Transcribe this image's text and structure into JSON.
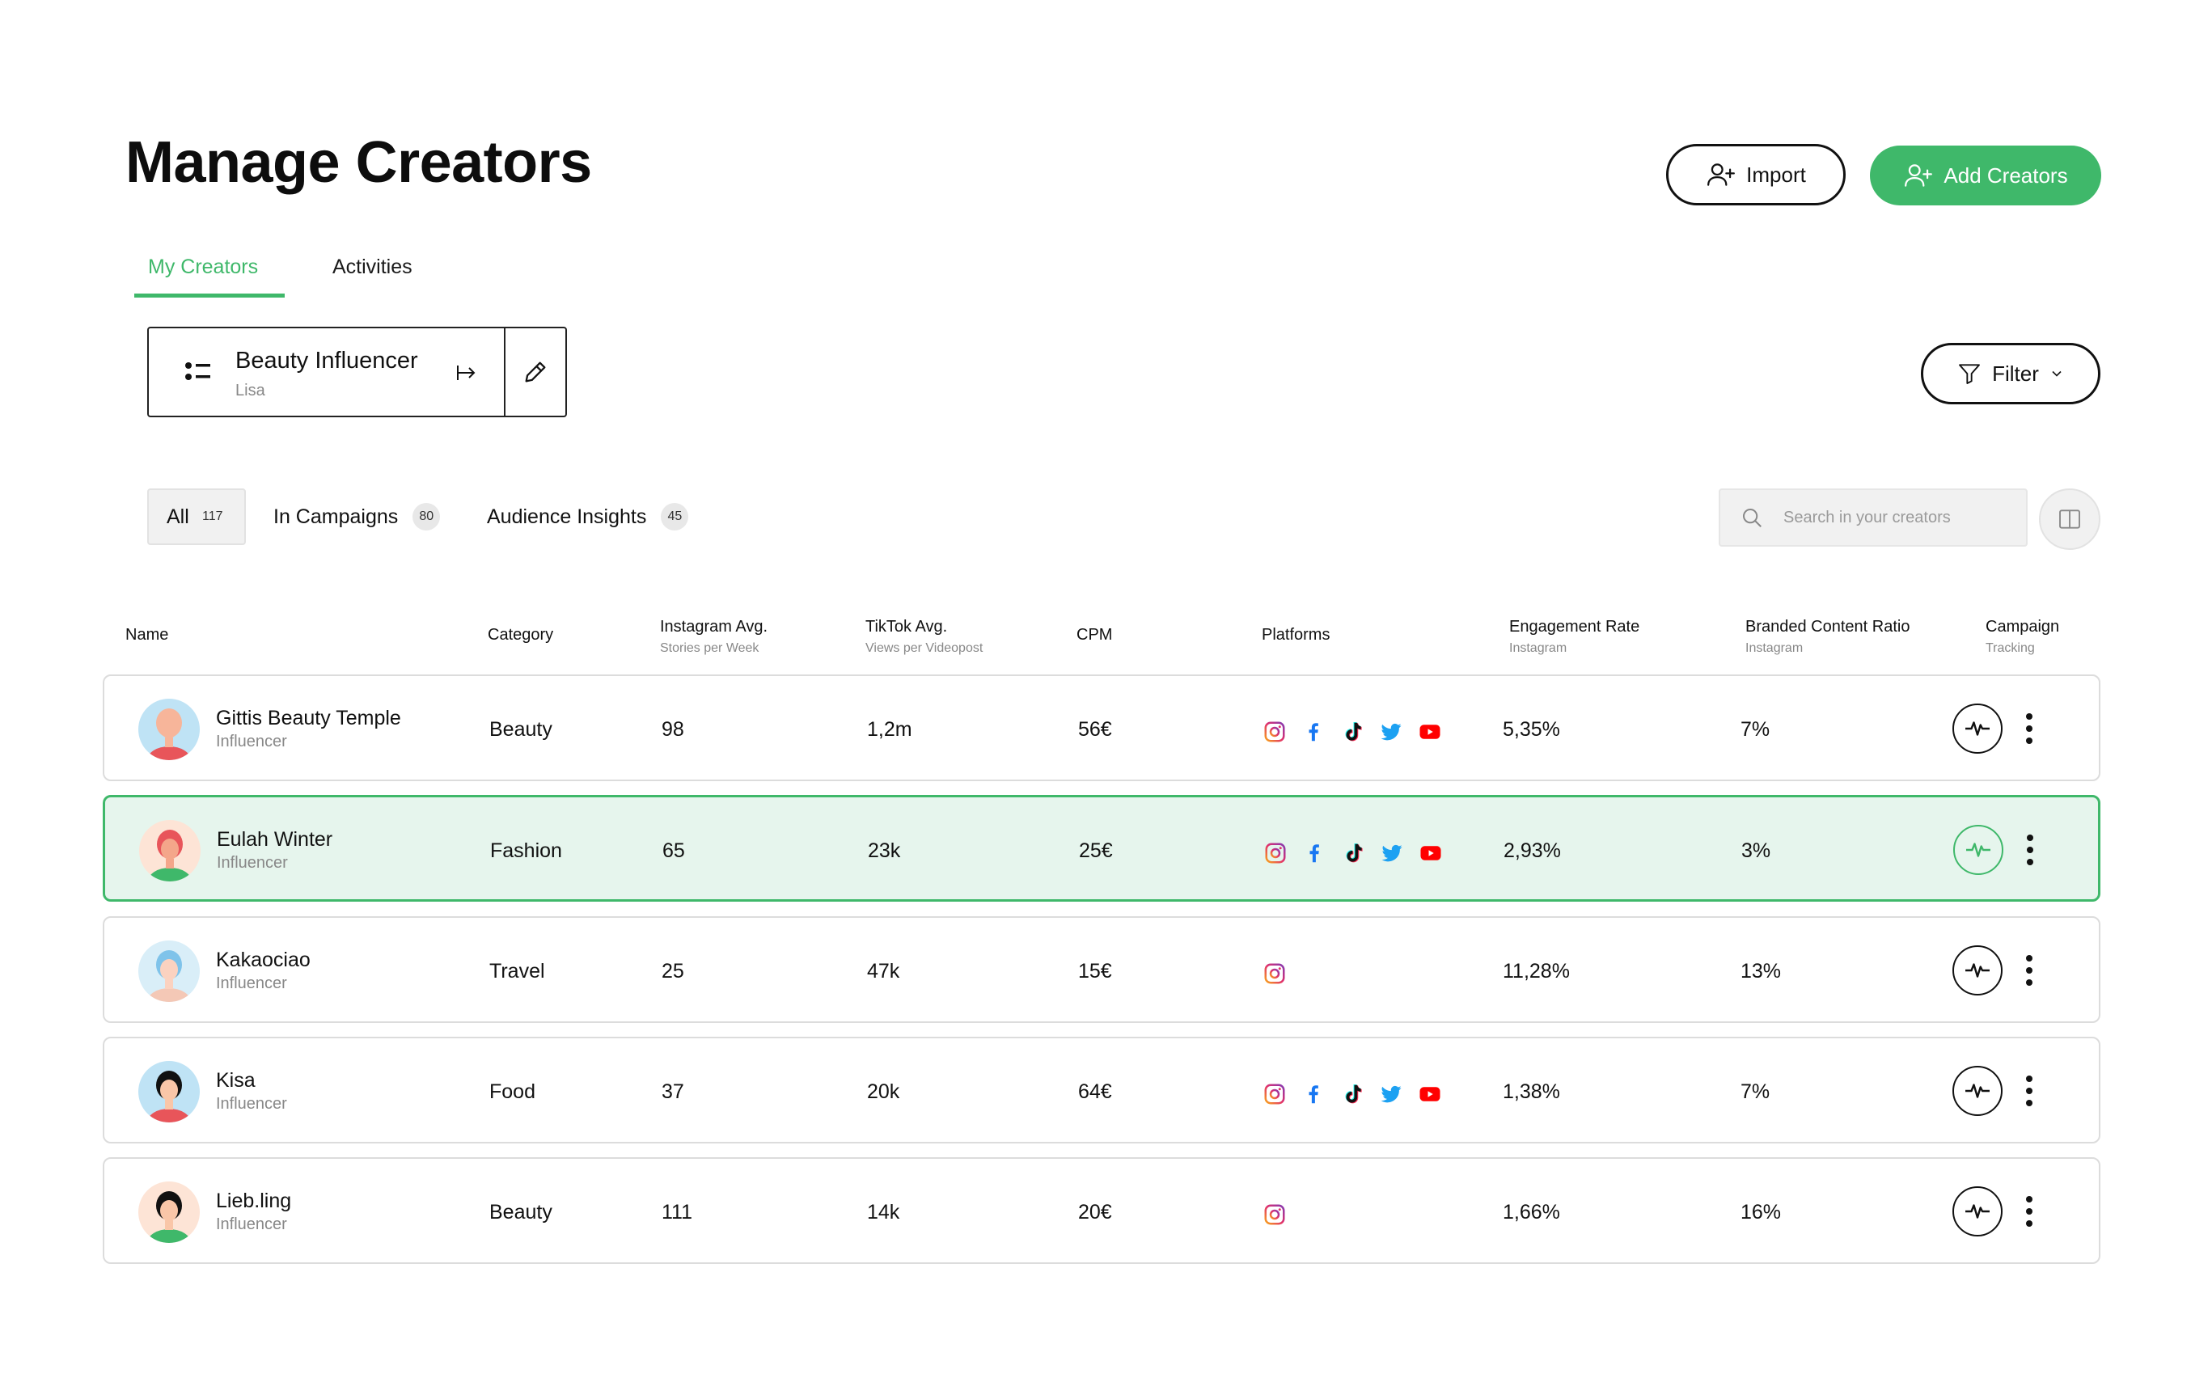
{
  "header": {
    "title": "Manage Creators",
    "import_label": "Import",
    "add_label": "Add Creators"
  },
  "tabs": [
    "My Creators",
    "Activities"
  ],
  "list": {
    "name": "Beauty Influencer",
    "owner": "Lisa"
  },
  "filter_label": "Filter",
  "segments": [
    {
      "label": "All",
      "count": "117"
    },
    {
      "label": "In Campaigns",
      "count": "80"
    },
    {
      "label": "Audience Insights",
      "count": "45"
    }
  ],
  "search": {
    "placeholder": "Search in your creators"
  },
  "columns": {
    "name": "Name",
    "category": "Category",
    "instagram": "Instagram Avg.",
    "instagram_sub": "Stories per Week",
    "tiktok": "TikTok Avg.",
    "tiktok_sub": "Views per Videopost",
    "cpm": "CPM",
    "platforms": "Platforms",
    "engagement": "Engagement Rate",
    "engagement_sub": "Instagram",
    "branded": "Branded Content Ratio",
    "branded_sub": "Instagram",
    "campaign": "Campaign",
    "campaign_sub": "Tracking"
  },
  "rows": [
    {
      "name": "Gittis Beauty Temple",
      "role": "Influencer",
      "category": "Beauty",
      "instagram": "98",
      "tiktok": "1,2m",
      "cpm": "56€",
      "platforms": [
        "instagram-icon",
        "facebook-icon",
        "tiktok-icon",
        "twitter-icon",
        "youtube-icon"
      ],
      "engagement": "5,35%",
      "branded": "7%",
      "active": false
    },
    {
      "name": "Eulah Winter",
      "role": "Influencer",
      "category": "Fashion",
      "instagram": "65",
      "tiktok": "23k",
      "cpm": "25€",
      "platforms": [
        "instagram-icon",
        "facebook-icon",
        "tiktok-icon",
        "twitter-icon",
        "youtube-icon"
      ],
      "engagement": "2,93%",
      "branded": "3%",
      "active": true
    },
    {
      "name": "Kakaociao",
      "role": "Influencer",
      "category": "Travel",
      "instagram": "25",
      "tiktok": "47k",
      "cpm": "15€",
      "platforms": [
        "instagram-icon"
      ],
      "engagement": "11,28%",
      "branded": "13%",
      "active": false
    },
    {
      "name": "Kisa",
      "role": "Influencer",
      "category": "Food",
      "instagram": "37",
      "tiktok": "20k",
      "cpm": "64€",
      "platforms": [
        "instagram-icon",
        "facebook-icon",
        "tiktok-icon",
        "twitter-icon",
        "youtube-icon"
      ],
      "engagement": "1,38%",
      "branded": "7%",
      "active": false
    },
    {
      "name": "Lieb.ling",
      "role": "Influencer",
      "category": "Beauty",
      "instagram": "111",
      "tiktok": "14k",
      "cpm": "20€",
      "platforms": [
        "instagram-icon"
      ],
      "engagement": "1,66%",
      "branded": "16%",
      "active": false
    }
  ],
  "colors": {
    "accent": "#3fb86a",
    "active_row_bg": "#e6f5ed"
  }
}
